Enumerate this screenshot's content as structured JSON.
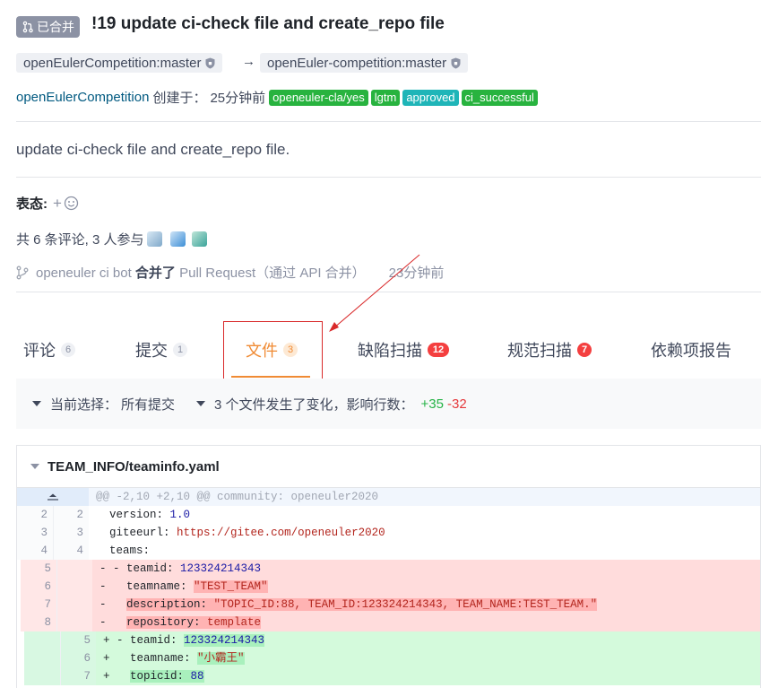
{
  "pr": {
    "status": "已合并",
    "title": "!19 update ci-check file and create_repo file",
    "source_branch": "openEulerCompetition:master",
    "arrow": "→",
    "target_branch": "openEuler-competition:master",
    "author": "openEulerCompetition",
    "created_label": "创建于：",
    "created_time": "25分钟前",
    "labels": [
      {
        "text": "openeuler-cla/yes",
        "color": "#28b33f"
      },
      {
        "text": "lgtm",
        "color": "#28b33f"
      },
      {
        "text": "approved",
        "color": "#1fb5b8"
      },
      {
        "text": "ci_successful",
        "color": "#28b33f"
      }
    ],
    "description": "update ci-check file and create_repo file."
  },
  "reactions": {
    "label": "表态:",
    "add": "+"
  },
  "participants": {
    "text": "共 6 条评论, 3 人参与"
  },
  "merge_event": {
    "user": "openeuler ci bot",
    "action": "合并了",
    "object": "Pull Request（通过 API 合并）",
    "time": "23分钟前"
  },
  "tabs": [
    {
      "label": "评论",
      "count": "6"
    },
    {
      "label": "提交",
      "count": "1"
    },
    {
      "label": "文件",
      "count": "3"
    },
    {
      "label": "缺陷扫描",
      "count": "12"
    },
    {
      "label": "规范扫描",
      "count": "7"
    },
    {
      "label": "依赖项报告",
      "count": ""
    }
  ],
  "filter": {
    "current_label": "当前选择：",
    "current_value": "所有提交",
    "changes_text": "3 个文件发生了变化，影响行数：",
    "additions": "+35",
    "deletions": "-32"
  },
  "file": {
    "name": "TEAM_INFO/teaminfo.yaml",
    "hunk": "@@ -2,10 +2,10 @@ community: openeuler2020",
    "lines": [
      {
        "old": "2",
        "new": "2",
        "type": "ctx",
        "sign": " ",
        "key": "version",
        "value": "1.0",
        "vclass": "num"
      },
      {
        "old": "3",
        "new": "3",
        "type": "ctx",
        "sign": " ",
        "key": "giteeurl",
        "value": "https://gitee.com/openeuler2020",
        "vclass": "url"
      },
      {
        "old": "4",
        "new": "4",
        "type": "ctx",
        "sign": " ",
        "key": "teams",
        "value": "",
        "vclass": ""
      },
      {
        "old": "5",
        "new": "",
        "type": "del",
        "sign": "- -",
        "key": "teamid",
        "value": "123324214343",
        "vclass": "num"
      },
      {
        "old": "6",
        "new": "",
        "type": "del",
        "sign": "-  ",
        "key": "teamname",
        "value": "\"TEST_TEAM\"",
        "vclass": "str"
      },
      {
        "old": "7",
        "new": "",
        "type": "del",
        "sign": "-  ",
        "key": "description",
        "value": "\"TOPIC_ID:88, TEAM_ID:123324214343, TEAM_NAME:TEST_TEAM.\"",
        "vclass": "str"
      },
      {
        "old": "8",
        "new": "",
        "type": "del",
        "sign": "-  ",
        "key": "repository",
        "value": "template",
        "vclass": "str"
      },
      {
        "old": "",
        "new": "5",
        "type": "add",
        "sign": "+ -",
        "key": "teamid",
        "value": "123324214343",
        "vclass": "num"
      },
      {
        "old": "",
        "new": "6",
        "type": "add",
        "sign": "+  ",
        "key": "teamname",
        "value": "\"小霸王\"",
        "vclass": "str"
      },
      {
        "old": "",
        "new": "7",
        "type": "add",
        "sign": "+  ",
        "key": "topicid",
        "value": "88",
        "vclass": "num"
      }
    ]
  }
}
